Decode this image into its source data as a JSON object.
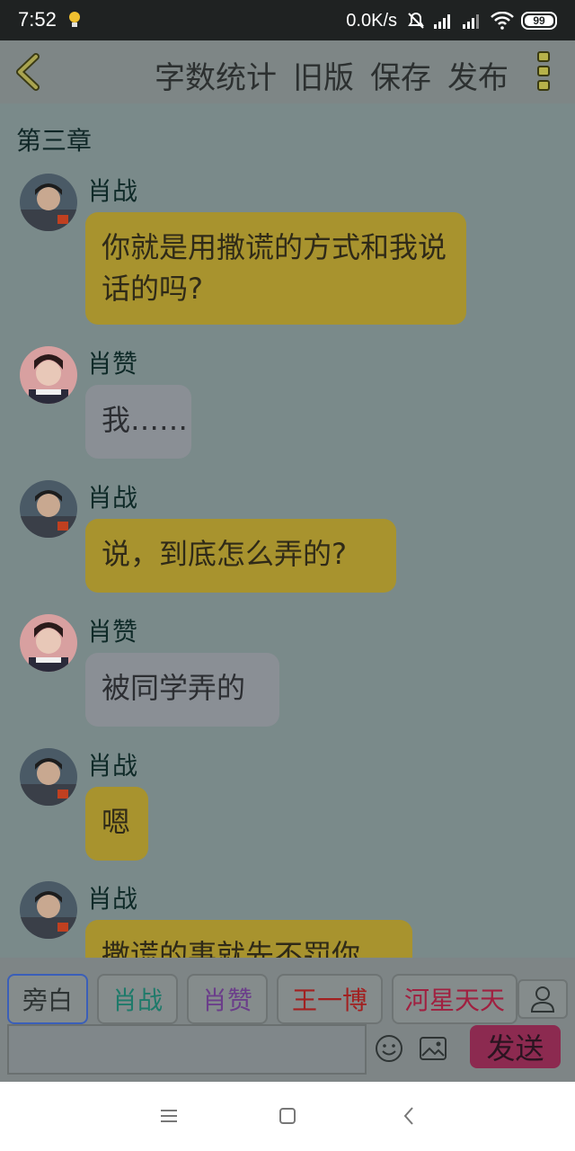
{
  "status_bar": {
    "time": "7:52",
    "net_speed": "0.0K/s",
    "battery": "99"
  },
  "toolbar": {
    "actions": [
      "字数统计",
      "旧版",
      "保存",
      "发布"
    ]
  },
  "chapter_title": "第三章",
  "messages": [
    {
      "sender": "肖战",
      "text": "你就是用撒谎的方式和我说话的吗?",
      "style": "yellow"
    },
    {
      "sender": "肖赞",
      "text": "我……",
      "style": "gray"
    },
    {
      "sender": "肖战",
      "text": "说，到底怎么弄的?",
      "style": "yellow"
    },
    {
      "sender": "肖赞",
      "text": "被同学弄的",
      "style": "gray"
    },
    {
      "sender": "肖战",
      "text": "嗯",
      "style": "yellow"
    },
    {
      "sender": "肖战",
      "text": "撒谎的事就先不罚你",
      "style": "yellow"
    }
  ],
  "composer": {
    "characters": [
      {
        "label": "旁白",
        "color": "#2e3434"
      },
      {
        "label": "肖战",
        "color": "#1e7a6a"
      },
      {
        "label": "肖赞",
        "color": "#6b3e8a"
      },
      {
        "label": "王一博",
        "color": "#a22020"
      },
      {
        "label": "河星天天",
        "color": "#a02040"
      }
    ],
    "send_label": "发送",
    "input_value": ""
  },
  "icons": {
    "back": "back-chevron-icon",
    "more": "more-vertical-icon",
    "person": "person-icon",
    "emoji": "emoji-icon",
    "image": "image-icon"
  }
}
